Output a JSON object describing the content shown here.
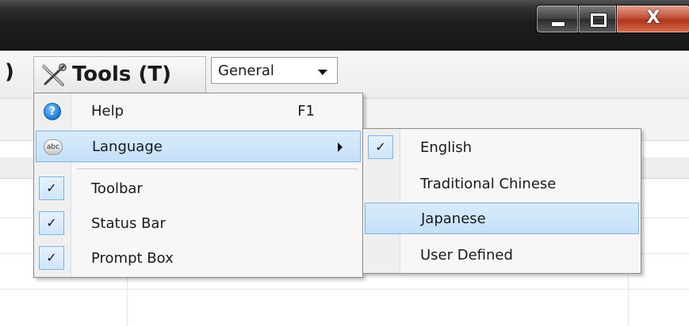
{
  "window": {
    "buttons": {
      "minimize": "minimize",
      "maximize": "maximize",
      "close": "X"
    }
  },
  "menubar": {
    "partial_label": ")",
    "tools_label": "Tools (T)",
    "combo_value": "General"
  },
  "tools_menu": {
    "items": [
      {
        "label": "Help",
        "shortcut": "F1",
        "icon": "help-icon"
      },
      {
        "label": "Language",
        "icon": "abc-icon",
        "highlighted": true,
        "has_submenu": true
      },
      {
        "label": "Toolbar",
        "checked": true
      },
      {
        "label": "Status Bar",
        "checked": true
      },
      {
        "label": "Prompt Box",
        "checked": true
      }
    ]
  },
  "language_menu": {
    "items": [
      {
        "label": "English",
        "checked": true
      },
      {
        "label": "Traditional Chinese"
      },
      {
        "label": "Japanese",
        "highlighted": true
      },
      {
        "label": "User Defined"
      }
    ]
  },
  "glyphs": {
    "check": "✓",
    "help": "?",
    "abc": "abc"
  },
  "colors": {
    "highlight": "#c4e0f8",
    "highlight_border": "#7fb2e5",
    "close_button": "#c0523b"
  }
}
